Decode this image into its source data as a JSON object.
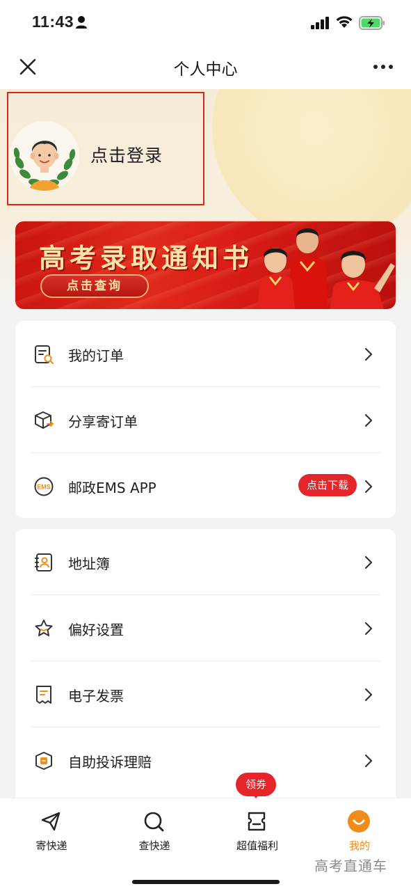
{
  "status_bar": {
    "time": "11:43"
  },
  "nav": {
    "title": "个人中心"
  },
  "profile": {
    "login_text": "点击登录"
  },
  "banner": {
    "title": "高考录取通知书",
    "button_label": "点击查询"
  },
  "menu_group_1": {
    "items": [
      {
        "label": "我的订单",
        "icon": "order-search-icon"
      },
      {
        "label": "分享寄订单",
        "icon": "package-share-icon"
      },
      {
        "label": "邮政EMS APP",
        "icon": "ems-logo-icon",
        "badge": "点击下载"
      }
    ]
  },
  "menu_group_2": {
    "items": [
      {
        "label": "地址簿",
        "icon": "address-book-icon"
      },
      {
        "label": "偏好设置",
        "icon": "star-settings-icon"
      },
      {
        "label": "电子发票",
        "icon": "invoice-icon"
      },
      {
        "label": "自助投诉理赔",
        "icon": "claim-shield-icon"
      }
    ]
  },
  "tab_bar": {
    "coupon_badge": "领券",
    "tabs": [
      {
        "label": "寄快递",
        "icon": "send-plane-icon"
      },
      {
        "label": "查快递",
        "icon": "search-icon"
      },
      {
        "label": "超值福利",
        "icon": "gift-card-icon"
      },
      {
        "label": "我的",
        "icon": "profile-smile-icon",
        "active": true
      }
    ]
  },
  "watermark": "高考直通车",
  "colors": {
    "accent_red": "#e4262b",
    "active_orange": "#f08c1a",
    "header_bg": "#f6ecd9",
    "banner_red": "#d61b16"
  }
}
